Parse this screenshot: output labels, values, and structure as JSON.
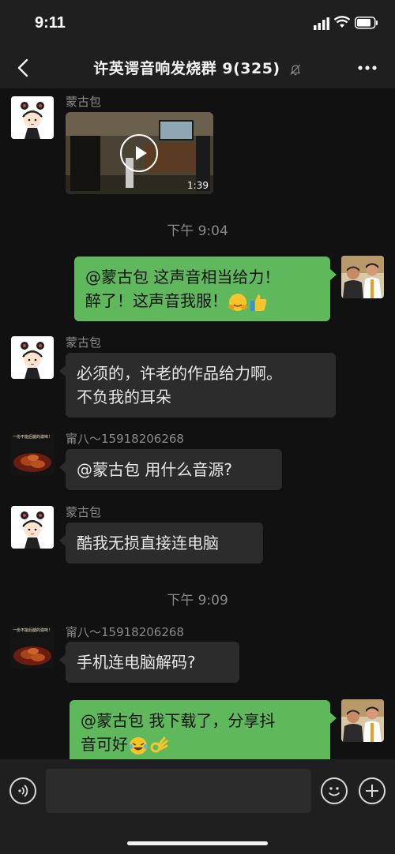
{
  "status": {
    "time": "9:11"
  },
  "header": {
    "title": "许英谔音响发烧群 9(325)"
  },
  "messages": [
    {
      "sender": "蒙古包",
      "video_duration": "1:39"
    },
    {
      "timestamp": "下午 9:04"
    },
    {
      "text_line1": "@蒙古包 这声音相当给力！",
      "text_line2": "醉了！这声音我服！"
    },
    {
      "sender": "蒙古包",
      "text_line1": "必须的，许老的作品给力啊。",
      "text_line2": "不负我的耳朵"
    },
    {
      "sender": "甯八～15918206268",
      "text": "@蒙古包 用什么音源?"
    },
    {
      "sender": "蒙古包",
      "text": "酷我无损直接连电脑"
    },
    {
      "timestamp": "下午 9:09"
    },
    {
      "sender": "甯八～15918206268",
      "text": "手机连电脑解码?"
    },
    {
      "text_line1": "@蒙古包 我下载了，分享抖",
      "text_line2": "音可好"
    }
  ],
  "avatar_caption": "一份不能后腿的滋味！",
  "composer": {
    "value": ""
  },
  "colors": {
    "sent_bubble": "#5fb95c",
    "recv_bubble": "#2c2c2c",
    "background": "#111111",
    "bar": "#1f1f1f"
  }
}
